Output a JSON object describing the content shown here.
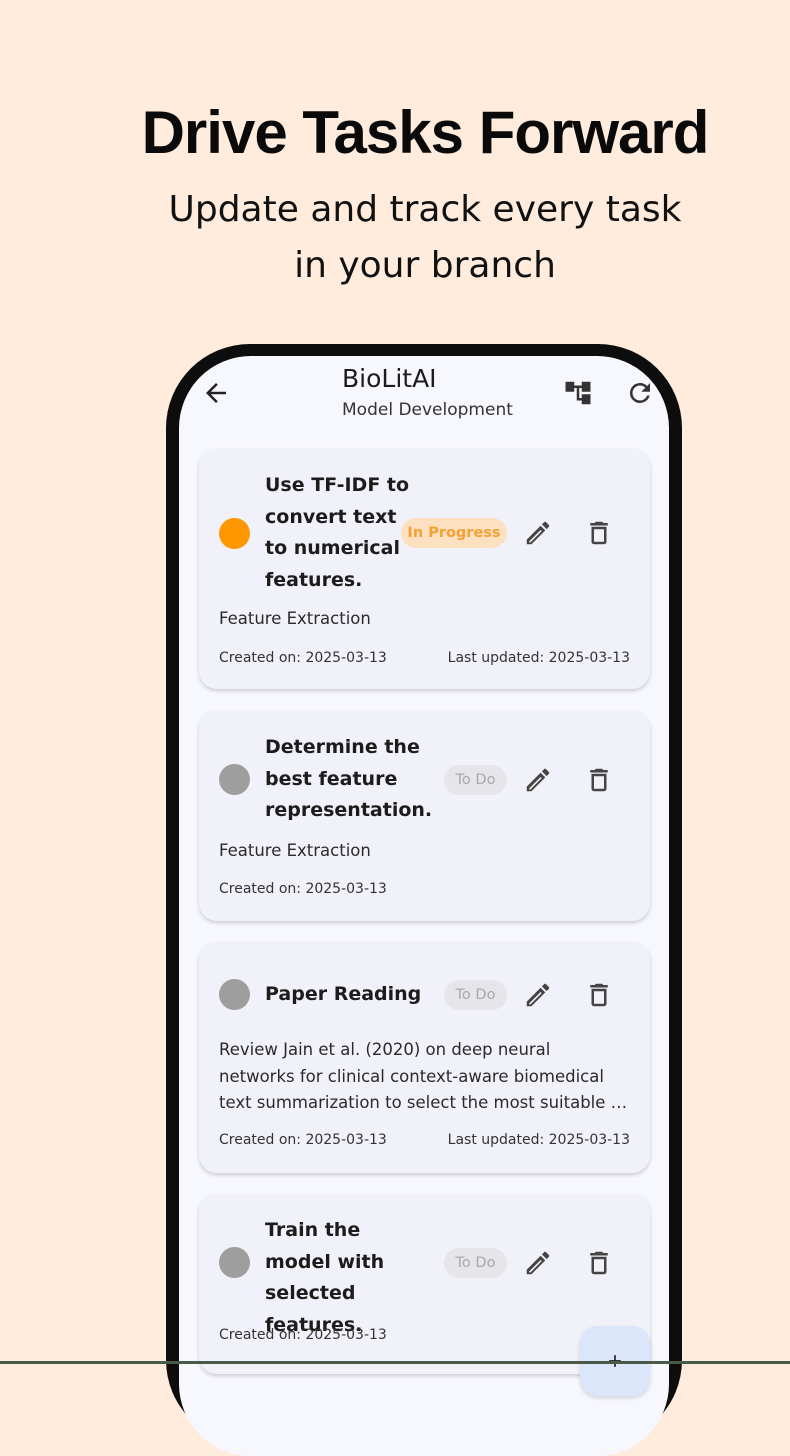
{
  "promo": {
    "headline": "Drive Tasks Forward",
    "subline_1": "Update and track every task",
    "subline_2": "in your branch"
  },
  "appbar": {
    "title": "BioLitAI",
    "subtitle": "Model Development",
    "icons": [
      "arrow-back-icon",
      "account-tree-icon",
      "refresh-icon"
    ]
  },
  "status_colors": {
    "in_progress": "#ff9800",
    "todo": "#9e9e9e"
  },
  "tasks": [
    {
      "title": "Use TF-IDF to convert text to numerical features.",
      "status": "In Progress",
      "description": "Feature Extraction",
      "created": "Created on: 2025-03-13",
      "updated": "Last updated: 2025-03-13"
    },
    {
      "title": "Determine the best feature representation.",
      "status": "To Do",
      "description": "Feature Extraction",
      "created": "Created on: 2025-03-13"
    },
    {
      "title": "Paper Reading",
      "status": "To Do",
      "description": "Review Jain et al. (2020) on deep neural networks for clinical context-aware biomedical text summarization to select the most suitable …",
      "created": "Created on: 2025-03-13",
      "updated": "Last updated: 2025-03-13"
    },
    {
      "title": "Train the model with selected features.",
      "status": "To Do",
      "created": "Created on: 2025-03-13"
    }
  ],
  "fab": {
    "icon": "add-icon"
  }
}
